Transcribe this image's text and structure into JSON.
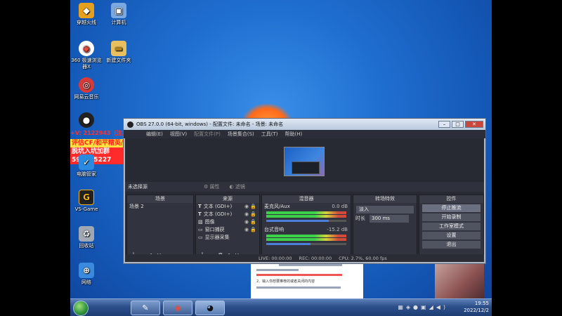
{
  "desktop": {
    "icons": [
      {
        "label": "穿越火线",
        "glyph": "◆",
        "color": "#e6a020"
      },
      {
        "label": "计算机",
        "glyph": "▣",
        "color": "#7aa8e0"
      },
      {
        "label": "360 极速浏览器X",
        "glyph": "◉",
        "color": "#e84c3a"
      },
      {
        "label": "新建文件夹",
        "glyph": "▬",
        "color": "#e8c060"
      },
      {
        "label": "网易云音乐",
        "glyph": "◎",
        "color": "#d83a3a"
      },
      {
        "label": "电脑管家",
        "glyph": "✓",
        "color": "#2a8ae0"
      },
      {
        "label": "VS-Game",
        "glyph": "G",
        "color": "#222222"
      },
      {
        "label": "回收站",
        "glyph": "♻",
        "color": "#a0a8b4"
      },
      {
        "label": "网络",
        "glyph": "⊕",
        "color": "#3a8ae0"
      }
    ],
    "promo": {
      "line1": "+V: 2122943（注入备注）",
      "line2": "评估CF/和平精英/手游",
      "line3": "脱坑入坑加群597685227"
    }
  },
  "background_window": {
    "text_note": "2、输入你想要推荐的或者关闭的内容"
  },
  "obs": {
    "title": "OBS 27.0.0 (64-bit, windows) - 配置文件: 未命名 - 场景: 未命名",
    "menu": [
      "编辑(E)",
      "视图(V)",
      "配置文件(P)",
      "场景集合(S)",
      "工具(T)",
      "帮助(H)"
    ],
    "toolbar": {
      "no_source": "未选择源",
      "properties": "属性",
      "filters": "滤镜"
    },
    "docks": {
      "scenes": {
        "title": "场景",
        "items": [
          "场景 2"
        ]
      },
      "sources": {
        "title": "来源",
        "items": [
          "文本 (GDI+)",
          "文本 (GDI+)",
          "图像",
          "窗口捕获",
          "显示器采集"
        ]
      },
      "mixer": {
        "title": "混音器",
        "channels": [
          {
            "name": "麦克风/Aux",
            "db": "0.0 dB",
            "level": 0.78
          },
          {
            "name": "台式音响",
            "db": "-15.2 dB",
            "level": 0.55
          }
        ]
      },
      "transitions": {
        "title": "转场特效",
        "selected": "淡入",
        "duration_label": "时长",
        "duration": "300 ms"
      },
      "controls": {
        "title": "控件",
        "buttons": [
          "停止推流",
          "开始录制",
          "工作室模式",
          "设置",
          "退出"
        ]
      }
    },
    "status": {
      "live": "LIVE: 00:00:00",
      "rec": "REC: 00:00:00",
      "cpu": "CPU: 2.7%, 60.00 fps"
    }
  },
  "taskbar": {
    "time": "19:55",
    "date": "2022/12/2"
  }
}
